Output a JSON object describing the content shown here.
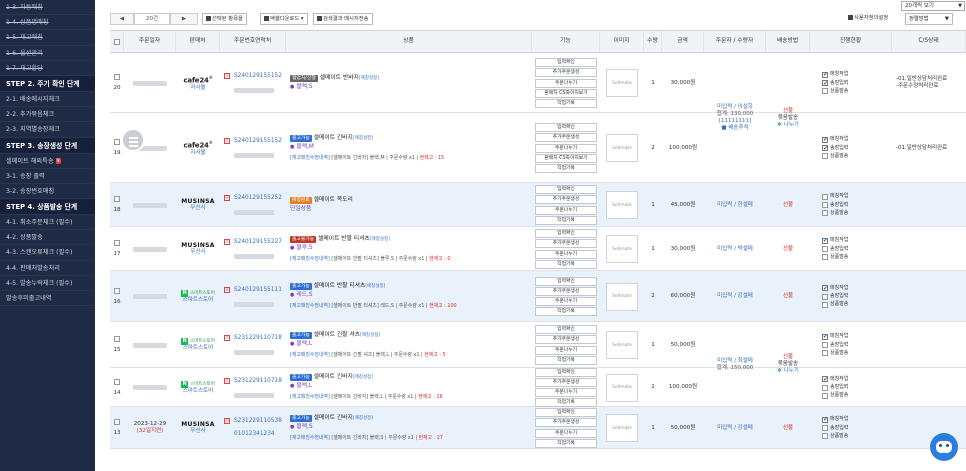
{
  "sidebar": {
    "items": [
      {
        "label": "1-3. 자동매칭",
        "style": "strike"
      },
      {
        "label": "1-4. 상품명매칭",
        "style": "strike"
      },
      {
        "label": "1-5. 재고매칭",
        "style": "strike"
      },
      {
        "label": "1-6. 옵션관리",
        "style": "strike"
      },
      {
        "label": "1-7. 재고할당",
        "style": "strike"
      },
      {
        "label": "STEP 2. 주기 확인 단계",
        "style": "section"
      },
      {
        "label": "2-1. 배송메시지체크",
        "style": "normal"
      },
      {
        "label": "2-2. 추가묶음체크",
        "style": "normal"
      },
      {
        "label": "2-3. 지역별송장체크",
        "style": "normal"
      },
      {
        "label": "STEP 3. 송장생성 단계",
        "style": "section"
      },
      {
        "label": "셀메이트 해외특송",
        "style": "normal",
        "badge": "N"
      },
      {
        "label": "3-1. 송장 출력",
        "style": "normal"
      },
      {
        "label": "3-2. 송장번호매칭",
        "style": "normal"
      },
      {
        "label": "STEP 4. 상품발송 단계",
        "style": "section"
      },
      {
        "label": "4-1. 취소주문체크 (필수)",
        "style": "normal"
      },
      {
        "label": "4-2. 상품발송",
        "style": "normal"
      },
      {
        "label": "4-3. 스캔오류체크 (필수)",
        "style": "normal"
      },
      {
        "label": "4-4. 판매처발송처리",
        "style": "normal"
      },
      {
        "label": "4-5. 발송누락체크 (필수)",
        "style": "normal"
      },
      {
        "label": "발송후미출고내역",
        "style": "normal"
      }
    ]
  },
  "top": {
    "per_page": "20개씩 보기",
    "sort": "정렬방법"
  },
  "toolbar": {
    "page_box": "20건",
    "btn_selected": "선택된 항목을",
    "btn_excel": "엑셀다운로드",
    "btn_search_msg": "검색결과 메시지전송",
    "btn_user_setting": "사용자정의설정"
  },
  "columns": [
    "",
    "주문일자",
    "판매처",
    "주문번호\n연락처",
    "상품",
    "기능",
    "이미지",
    "수량",
    "금액",
    "주문자 / 수령자",
    "배송방법",
    "진행현황",
    "C/S상태"
  ],
  "function_buttons": [
    "입력확인",
    "추가주문생성",
    "주문나누기",
    "판매처 CS화이지보기",
    "작업기록"
  ],
  "image_placeholder": "Sellmate",
  "status_labels": [
    "매칭작업",
    "송장입력",
    "상품발송"
  ],
  "rows": [
    {
      "num": "20",
      "seller": "cafe24",
      "seller_name": "자사몰",
      "order_no": "S240129155152",
      "badge": "협업처/진행",
      "badge_color": "gray",
      "name": "셀메이트 반바지",
      "hint": "[매칭설정]",
      "option": "블랙,S",
      "meta": "",
      "qty": "1",
      "price": "30,000원",
      "recv": "미입력 / 이설희",
      "recv2": "합계: 130,000",
      "recv3": "[11111111]",
      "recv4": "배송추적",
      "ship": "선불",
      "ship2": "묶음발송",
      "ship3": "나누기",
      "checks": [
        true,
        true,
        false
      ],
      "cs": "-01.일반상담처리완료",
      "cs2": "-주문수정처리완료",
      "blue": false
    },
    {
      "num": "19",
      "seller": "cafe24",
      "seller_name": "자사몰",
      "order_no": "S240129155152",
      "badge": "출고가능",
      "badge_color": "blue",
      "name": "셀메이트 긴바지",
      "hint": "[매칭설정]",
      "option": "블랙,M",
      "meta_a": "[재고매칭수정내역]",
      "meta_b": "[셀메이트 긴바지] 블랙,M | 주문수량 x1 |",
      "meta_c": "현재고 : 15",
      "qty": "2",
      "price": "100,000원",
      "recv": "",
      "ship": "",
      "checks": [
        true,
        true,
        false
      ],
      "cs": "-01.일반상담처리완료",
      "blue": false
    },
    {
      "num": "18",
      "seller": "musinsa",
      "seller_name": "무신사",
      "order_no": "S240129155252",
      "badge": "매칭완료",
      "badge_color": "orange",
      "name": "셀메이트 목도리",
      "set": "단일상품",
      "qty": "1",
      "price": "45,000원",
      "recv": "미입력 / 한셀메",
      "ship": "선불",
      "checks": [
        false,
        false,
        false
      ],
      "blue": true
    },
    {
      "num": "17",
      "seller": "musinsa",
      "seller_name": "무신사",
      "order_no": "S240129155227",
      "badge": "출고불가능",
      "badge_color": "red",
      "name": "셀메이트 반팔 티셔츠",
      "hint": "[매칭설정]",
      "option": "블루,S",
      "meta_a": "[재고매칭수정내역]",
      "meta_b": "[셀메이트 반팔 티셔츠] 블루,S | 주문수량 x1 |",
      "meta_c": "현재고 : 0",
      "qty": "1",
      "price": "30,000원",
      "recv": "미입력 / 박셀메",
      "ship": "선불",
      "checks": [
        true,
        false,
        false
      ],
      "blue": false
    },
    {
      "num": "16",
      "seller": "smartstore",
      "seller_name": "스마트스토어",
      "order_no": "S240129155111",
      "badge": "출고가능",
      "badge_color": "blue",
      "name": "셀메이트 반팔 티셔츠",
      "hint": "[매칭설정]",
      "option": "레드,S",
      "meta_a": "[재고매칭수정내역]",
      "meta_b": "[셀메이트 반팔 티셔츠] 레드,S | 주문수량 x1 |",
      "meta_c": "현재고 : 100",
      "qty": "2",
      "price": "60,000원",
      "recv": "미입력 / 강셀메",
      "ship": "선불",
      "checks": [
        true,
        false,
        false
      ],
      "blue": true
    },
    {
      "num": "15",
      "seller": "smartstore",
      "seller_name": "스마트스토어",
      "order_no": "S231229110718",
      "badge": "출고가능",
      "badge_color": "blue",
      "name": "셀메이트 긴팔 셔츠",
      "hint": "[매칭설정]",
      "option": "블랙,L",
      "meta_a": "[재고매칭수정내역]",
      "meta_b": "[셀메이트 긴팔 셔츠] 블랙,L | 주문수량 x1 |",
      "meta_c": "현재고 : 5",
      "qty": "1",
      "price": "50,000원",
      "recv": "미입력 / 최셀메",
      "recv2": "합계: 150,000",
      "ship": "선불",
      "ship2": "묶음발송",
      "ship3": "나누기",
      "checks": [
        true,
        false,
        false
      ],
      "blue": false
    },
    {
      "num": "14",
      "seller": "smartstore",
      "seller_name": "스마트스토어",
      "order_no": "S231229110718",
      "badge": "출고가능",
      "badge_color": "blue",
      "name": "셀메이트 긴바지",
      "hint": "[매칭설정]",
      "option": "블랙,L",
      "meta_a": "[재고매칭수정내역]",
      "meta_b": "[셀메이트 긴바지] 블랙,L | 주문수량 x1 |",
      "meta_c": "현재고 : 16",
      "qty": "2",
      "price": "100,000원",
      "recv": "",
      "ship": "",
      "checks": [
        true,
        false,
        false
      ],
      "blue": false
    },
    {
      "num": "13",
      "date": "2023-12-29",
      "date2": "(32일지연)",
      "seller": "musinsa",
      "seller_name": "무신사",
      "order_no": "S231229110538",
      "phone": "01012341234",
      "badge": "출고가능",
      "badge_color": "blue",
      "name": "셀메이트 긴바지",
      "hint": "[매칭설정]",
      "option": "블랙,S",
      "meta_a": "[재고매칭수정내역]",
      "meta_b": "[셀메이트 긴바지] 블랙,S | 주문수량 x1 |",
      "meta_c": "현재고 : 27",
      "qty": "1",
      "price": "50,000원",
      "recv": "미입력 / 강셀메",
      "ship": "선불",
      "checks": [
        true,
        false,
        false
      ],
      "blue": true
    }
  ],
  "colors": {
    "sidebar_bg": "#1f2a44",
    "link": "#3a6fbf",
    "red": "#d0302e",
    "highlight_row": "#e9f1fb"
  }
}
